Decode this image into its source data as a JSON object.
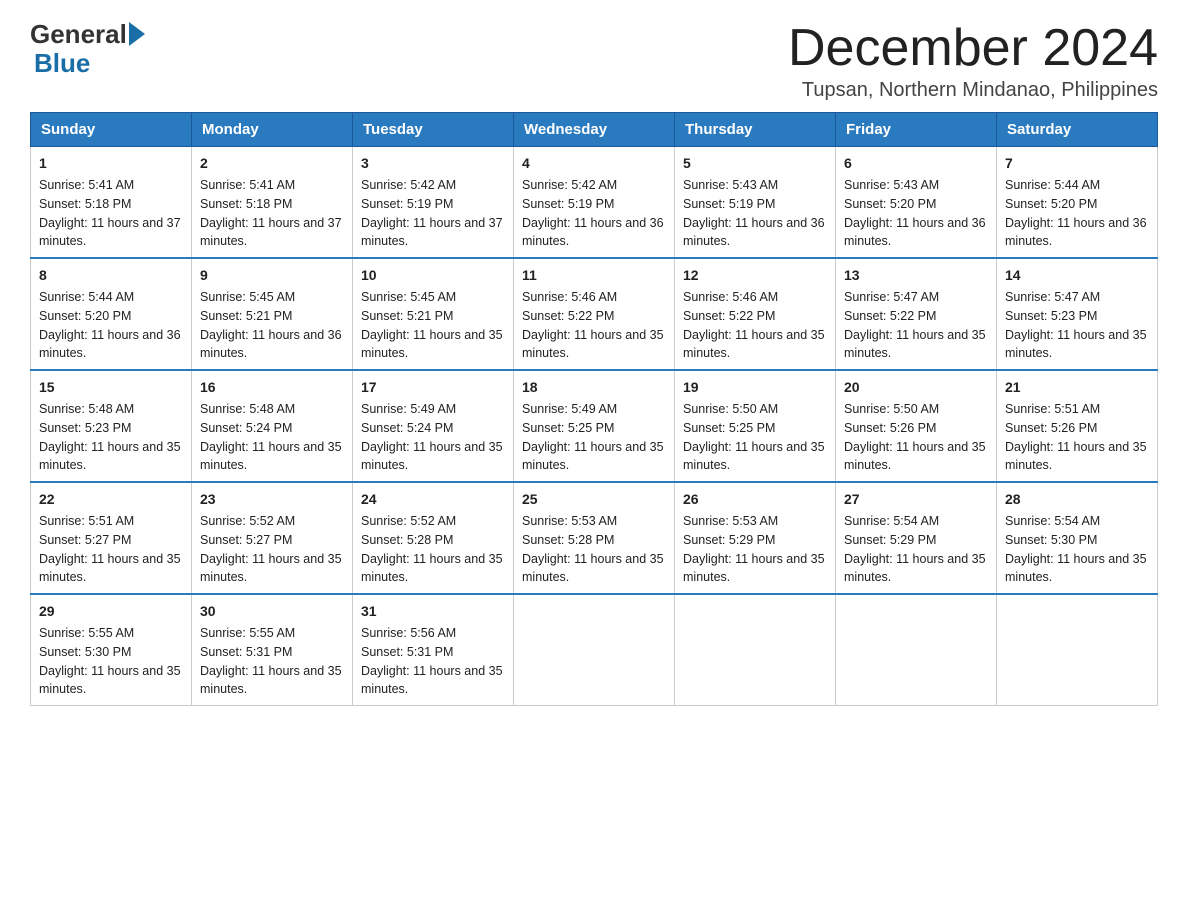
{
  "logo": {
    "text_general": "General",
    "text_blue": "Blue"
  },
  "header": {
    "month_year": "December 2024",
    "location": "Tupsan, Northern Mindanao, Philippines"
  },
  "days_of_week": [
    "Sunday",
    "Monday",
    "Tuesday",
    "Wednesday",
    "Thursday",
    "Friday",
    "Saturday"
  ],
  "weeks": [
    [
      {
        "day": "1",
        "sunrise": "5:41 AM",
        "sunset": "5:18 PM",
        "daylight": "11 hours and 37 minutes."
      },
      {
        "day": "2",
        "sunrise": "5:41 AM",
        "sunset": "5:18 PM",
        "daylight": "11 hours and 37 minutes."
      },
      {
        "day": "3",
        "sunrise": "5:42 AM",
        "sunset": "5:19 PM",
        "daylight": "11 hours and 37 minutes."
      },
      {
        "day": "4",
        "sunrise": "5:42 AM",
        "sunset": "5:19 PM",
        "daylight": "11 hours and 36 minutes."
      },
      {
        "day": "5",
        "sunrise": "5:43 AM",
        "sunset": "5:19 PM",
        "daylight": "11 hours and 36 minutes."
      },
      {
        "day": "6",
        "sunrise": "5:43 AM",
        "sunset": "5:20 PM",
        "daylight": "11 hours and 36 minutes."
      },
      {
        "day": "7",
        "sunrise": "5:44 AM",
        "sunset": "5:20 PM",
        "daylight": "11 hours and 36 minutes."
      }
    ],
    [
      {
        "day": "8",
        "sunrise": "5:44 AM",
        "sunset": "5:20 PM",
        "daylight": "11 hours and 36 minutes."
      },
      {
        "day": "9",
        "sunrise": "5:45 AM",
        "sunset": "5:21 PM",
        "daylight": "11 hours and 36 minutes."
      },
      {
        "day": "10",
        "sunrise": "5:45 AM",
        "sunset": "5:21 PM",
        "daylight": "11 hours and 35 minutes."
      },
      {
        "day": "11",
        "sunrise": "5:46 AM",
        "sunset": "5:22 PM",
        "daylight": "11 hours and 35 minutes."
      },
      {
        "day": "12",
        "sunrise": "5:46 AM",
        "sunset": "5:22 PM",
        "daylight": "11 hours and 35 minutes."
      },
      {
        "day": "13",
        "sunrise": "5:47 AM",
        "sunset": "5:22 PM",
        "daylight": "11 hours and 35 minutes."
      },
      {
        "day": "14",
        "sunrise": "5:47 AM",
        "sunset": "5:23 PM",
        "daylight": "11 hours and 35 minutes."
      }
    ],
    [
      {
        "day": "15",
        "sunrise": "5:48 AM",
        "sunset": "5:23 PM",
        "daylight": "11 hours and 35 minutes."
      },
      {
        "day": "16",
        "sunrise": "5:48 AM",
        "sunset": "5:24 PM",
        "daylight": "11 hours and 35 minutes."
      },
      {
        "day": "17",
        "sunrise": "5:49 AM",
        "sunset": "5:24 PM",
        "daylight": "11 hours and 35 minutes."
      },
      {
        "day": "18",
        "sunrise": "5:49 AM",
        "sunset": "5:25 PM",
        "daylight": "11 hours and 35 minutes."
      },
      {
        "day": "19",
        "sunrise": "5:50 AM",
        "sunset": "5:25 PM",
        "daylight": "11 hours and 35 minutes."
      },
      {
        "day": "20",
        "sunrise": "5:50 AM",
        "sunset": "5:26 PM",
        "daylight": "11 hours and 35 minutes."
      },
      {
        "day": "21",
        "sunrise": "5:51 AM",
        "sunset": "5:26 PM",
        "daylight": "11 hours and 35 minutes."
      }
    ],
    [
      {
        "day": "22",
        "sunrise": "5:51 AM",
        "sunset": "5:27 PM",
        "daylight": "11 hours and 35 minutes."
      },
      {
        "day": "23",
        "sunrise": "5:52 AM",
        "sunset": "5:27 PM",
        "daylight": "11 hours and 35 minutes."
      },
      {
        "day": "24",
        "sunrise": "5:52 AM",
        "sunset": "5:28 PM",
        "daylight": "11 hours and 35 minutes."
      },
      {
        "day": "25",
        "sunrise": "5:53 AM",
        "sunset": "5:28 PM",
        "daylight": "11 hours and 35 minutes."
      },
      {
        "day": "26",
        "sunrise": "5:53 AM",
        "sunset": "5:29 PM",
        "daylight": "11 hours and 35 minutes."
      },
      {
        "day": "27",
        "sunrise": "5:54 AM",
        "sunset": "5:29 PM",
        "daylight": "11 hours and 35 minutes."
      },
      {
        "day": "28",
        "sunrise": "5:54 AM",
        "sunset": "5:30 PM",
        "daylight": "11 hours and 35 minutes."
      }
    ],
    [
      {
        "day": "29",
        "sunrise": "5:55 AM",
        "sunset": "5:30 PM",
        "daylight": "11 hours and 35 minutes."
      },
      {
        "day": "30",
        "sunrise": "5:55 AM",
        "sunset": "5:31 PM",
        "daylight": "11 hours and 35 minutes."
      },
      {
        "day": "31",
        "sunrise": "5:56 AM",
        "sunset": "5:31 PM",
        "daylight": "11 hours and 35 minutes."
      },
      null,
      null,
      null,
      null
    ]
  ],
  "labels": {
    "sunrise": "Sunrise:",
    "sunset": "Sunset:",
    "daylight": "Daylight:"
  }
}
